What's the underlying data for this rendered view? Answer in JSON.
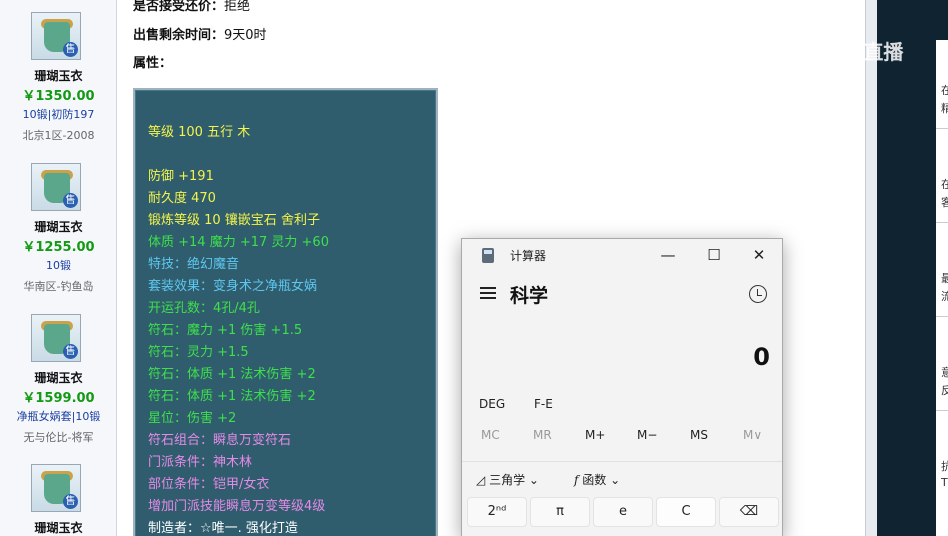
{
  "sidebar": {
    "items": [
      {
        "name": "珊瑚玉衣",
        "price": "￥1350.00",
        "desc": "10锻|初防197",
        "server": "北京1区-2008",
        "badge": "售"
      },
      {
        "name": "珊瑚玉衣",
        "price": "￥1255.00",
        "desc": "10锻",
        "server": "华南区-钓鱼岛",
        "badge": "售"
      },
      {
        "name": "珊瑚玉衣",
        "price": "￥1599.00",
        "desc": "净瓶女娲套|10锻",
        "server": "无与伦比-将军",
        "badge": "售"
      },
      {
        "name": "珊瑚玉衣",
        "badge": "售"
      }
    ]
  },
  "detail": {
    "accept_bargain_label": "是否接受还价：",
    "accept_bargain_value": "拒绝",
    "time_left_label": "出售剩余时间：",
    "time_left_value": "9天0时",
    "attributes_label": "属性：",
    "attribute_lines": [
      {
        "text": "等级 100 五行 木",
        "color": "#f4f44a"
      },
      {
        "text": "防御 +191",
        "color": "#f4f44a"
      },
      {
        "text": "耐久度 470",
        "color": "#f4f44a"
      },
      {
        "text": "锻炼等级 10 镶嵌宝石 舍利子",
        "color": "#f4f44a"
      },
      {
        "text": "体质 +14 魔力 +17 灵力 +60",
        "color": "#3ee04a"
      },
      {
        "text": "特技：绝幻魔音",
        "color": "#5ec7ef"
      },
      {
        "text": "套装效果：变身术之净瓶女娲",
        "color": "#5ec7ef"
      },
      {
        "text": "开运孔数：4孔/4孔",
        "color": "#3ee04a"
      },
      {
        "text": "符石：魔力 +1 伤害 +1.5",
        "color": "#3ee04a"
      },
      {
        "text": "符石：灵力 +1.5",
        "color": "#3ee04a"
      },
      {
        "text": "符石：体质 +1 法术伤害 +2",
        "color": "#3ee04a"
      },
      {
        "text": "符石：体质 +1 法术伤害 +2",
        "color": "#3ee04a"
      },
      {
        "text": "星位：伤害 +2",
        "color": "#3ee04a"
      },
      {
        "text": "符石组合：瞬息万变符石",
        "color": "#e58ae6"
      },
      {
        "text": "门派条件：神木林",
        "color": "#e58ae6"
      },
      {
        "text": "部位条件：铠甲/女衣",
        "color": "#e58ae6"
      },
      {
        "text": "增加门派技能瞬息万变等级4级",
        "color": "#e58ae6"
      },
      {
        "text": "制造者：☆唯一. 强化打造",
        "color": "#ffffff"
      }
    ]
  },
  "watermark": {
    "text": "CC直播"
  },
  "right_panel": {
    "snippets": [
      "在",
      "精",
      "在",
      "客",
      "最",
      "流",
      "意",
      "反",
      "抗",
      "T"
    ]
  },
  "calculator": {
    "title": "计算器",
    "mode": "科学",
    "display": "0",
    "angle_unit": "DEG",
    "fe_label": "F-E",
    "memory_buttons": [
      "MC",
      "MR",
      "M+",
      "M−",
      "MS",
      "M∨"
    ],
    "trig_label": "三角学",
    "function_label": "函数",
    "keys": [
      "2ⁿᵈ",
      "π",
      "e",
      "C",
      "⌫"
    ]
  },
  "colors": {
    "panel_bg": "#2f5d6e",
    "price": "#139a13",
    "page_dark": "#102331"
  }
}
